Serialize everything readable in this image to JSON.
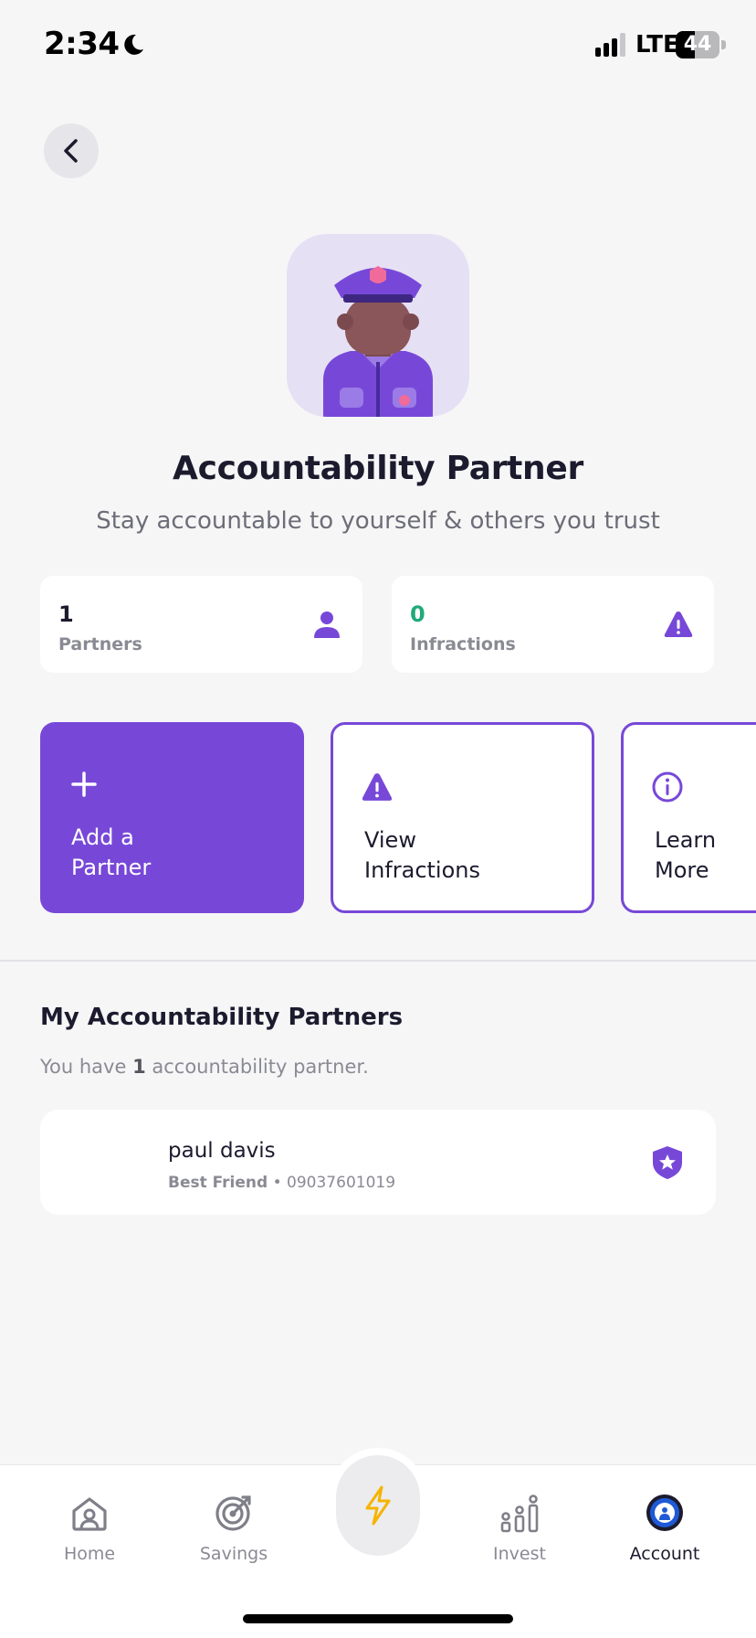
{
  "status_bar": {
    "time": "2:34",
    "network": "LTE",
    "battery": "44",
    "battery_level": 0.44
  },
  "hero": {
    "title": "Accountability Partner",
    "subtitle": "Stay accountable to yourself & others you trust"
  },
  "stats": [
    {
      "value": "1",
      "label": "Partners",
      "icon": "person-icon",
      "value_color": "#1c1b2e"
    },
    {
      "value": "0",
      "label": "Infractions",
      "icon": "warning-icon",
      "value_color": "#1faa78"
    }
  ],
  "actions": [
    {
      "line1": "Add a",
      "line2": "Partner",
      "icon": "plus-icon"
    },
    {
      "line1": "View",
      "line2": "Infractions",
      "icon": "warning-icon"
    },
    {
      "line1": "Learn",
      "line2": "More",
      "icon": "info-icon"
    }
  ],
  "partners_section": {
    "title": "My Accountability Partners",
    "subtitle_prefix": "You have ",
    "count": "1",
    "subtitle_suffix": " accountability partner."
  },
  "partners": [
    {
      "name": "paul davis",
      "relation": "Best Friend",
      "separator": " • ",
      "phone": "09037601019",
      "badge": "star-badge-icon"
    }
  ],
  "tabs": [
    {
      "label": "Home",
      "icon": "home-icon",
      "active": false
    },
    {
      "label": "Savings",
      "icon": "target-icon",
      "active": false
    },
    {
      "label": "Invest",
      "icon": "invest-icon",
      "active": false
    },
    {
      "label": "Account",
      "icon": "account-icon",
      "active": true
    }
  ],
  "center_action": {
    "icon": "lightning-icon"
  },
  "colors": {
    "accent": "#7748d8",
    "success": "#1faa78",
    "background": "#f6f6f7",
    "lightning": "#f5b400"
  }
}
